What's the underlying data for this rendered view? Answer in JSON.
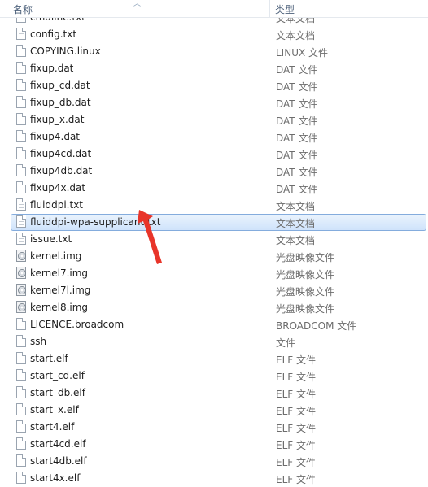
{
  "header": {
    "name_label": "名称",
    "type_label": "类型"
  },
  "partial_row": {
    "name": "cmdline.txt",
    "type": "文本文档",
    "icon": "text-file-icon"
  },
  "files": [
    {
      "name": "config.txt",
      "type": "文本文档",
      "icon": "text-file-icon"
    },
    {
      "name": "COPYING.linux",
      "type": "LINUX 文件",
      "icon": "file-icon"
    },
    {
      "name": "fixup.dat",
      "type": "DAT 文件",
      "icon": "file-icon"
    },
    {
      "name": "fixup_cd.dat",
      "type": "DAT 文件",
      "icon": "file-icon"
    },
    {
      "name": "fixup_db.dat",
      "type": "DAT 文件",
      "icon": "file-icon"
    },
    {
      "name": "fixup_x.dat",
      "type": "DAT 文件",
      "icon": "file-icon"
    },
    {
      "name": "fixup4.dat",
      "type": "DAT 文件",
      "icon": "file-icon"
    },
    {
      "name": "fixup4cd.dat",
      "type": "DAT 文件",
      "icon": "file-icon"
    },
    {
      "name": "fixup4db.dat",
      "type": "DAT 文件",
      "icon": "file-icon"
    },
    {
      "name": "fixup4x.dat",
      "type": "DAT 文件",
      "icon": "file-icon"
    },
    {
      "name": "fluiddpi.txt",
      "type": "文本文档",
      "icon": "text-file-icon"
    },
    {
      "name": "fluiddpi-wpa-supplicant.txt",
      "type": "文本文档",
      "icon": "text-file-icon",
      "selected": true
    },
    {
      "name": "issue.txt",
      "type": "文本文档",
      "icon": "text-file-icon"
    },
    {
      "name": "kernel.img",
      "type": "光盘映像文件",
      "icon": "disc-image-icon"
    },
    {
      "name": "kernel7.img",
      "type": "光盘映像文件",
      "icon": "disc-image-icon"
    },
    {
      "name": "kernel7l.img",
      "type": "光盘映像文件",
      "icon": "disc-image-icon"
    },
    {
      "name": "kernel8.img",
      "type": "光盘映像文件",
      "icon": "disc-image-icon"
    },
    {
      "name": "LICENCE.broadcom",
      "type": "BROADCOM 文件",
      "icon": "file-icon"
    },
    {
      "name": "ssh",
      "type": "文件",
      "icon": "file-icon"
    },
    {
      "name": "start.elf",
      "type": "ELF 文件",
      "icon": "file-icon"
    },
    {
      "name": "start_cd.elf",
      "type": "ELF 文件",
      "icon": "file-icon"
    },
    {
      "name": "start_db.elf",
      "type": "ELF 文件",
      "icon": "file-icon"
    },
    {
      "name": "start_x.elf",
      "type": "ELF 文件",
      "icon": "file-icon"
    },
    {
      "name": "start4.elf",
      "type": "ELF 文件",
      "icon": "file-icon"
    },
    {
      "name": "start4cd.elf",
      "type": "ELF 文件",
      "icon": "file-icon"
    },
    {
      "name": "start4db.elf",
      "type": "ELF 文件",
      "icon": "file-icon"
    },
    {
      "name": "start4x.elf",
      "type": "ELF 文件",
      "icon": "file-icon"
    }
  ],
  "colors": {
    "selection_border": "#84acdd",
    "selection_fill": "#cfe3fb",
    "annotation_arrow": "#e8352a",
    "type_text": "#6d6d6d"
  }
}
